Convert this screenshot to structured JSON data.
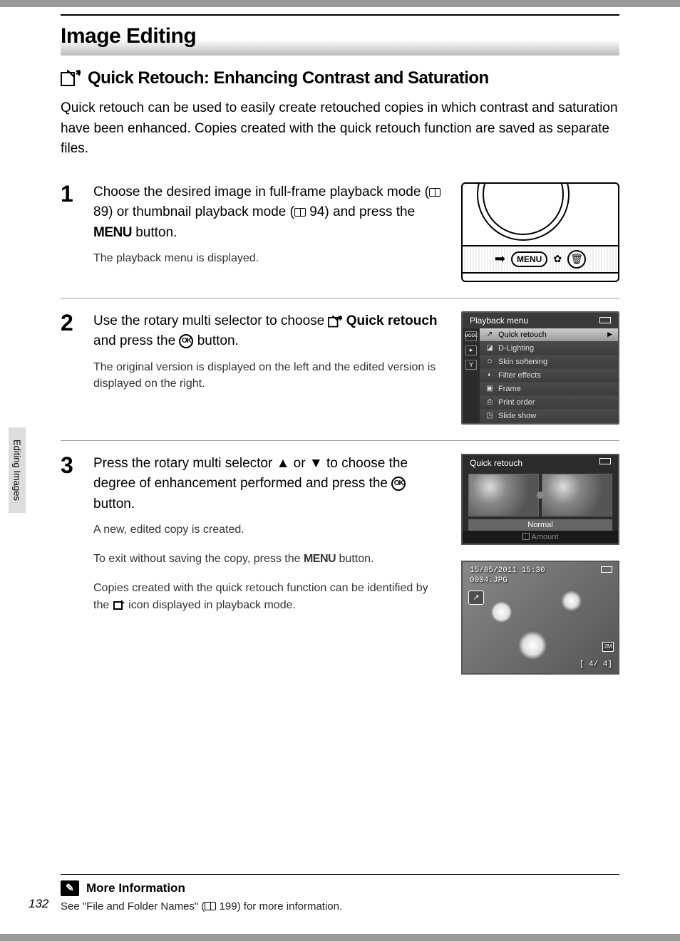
{
  "header": {
    "title": "Image Editing"
  },
  "section": {
    "heading": "Quick Retouch: Enhancing Contrast and Saturation"
  },
  "intro": "Quick retouch can be used to easily create retouched copies in which contrast and saturation have been enhanced. Copies created with the quick retouch function are saved as separate files.",
  "steps": [
    {
      "num": "1",
      "main_a": "Choose the desired image in full-frame playback mode (",
      "ref1": "89",
      "main_b": ") or thumbnail playback mode (",
      "ref2": "94",
      "main_c": ") and press the ",
      "btn": "MENU",
      "main_d": " button.",
      "sub": "The playback menu is displayed."
    },
    {
      "num": "2",
      "main_a": "Use the rotary multi selector to choose ",
      "strong": "Quick retouch",
      "main_b": " and press the ",
      "ok": "OK",
      "main_c": " button.",
      "sub": "The original version is displayed on the left and the edited version is displayed on the right."
    },
    {
      "num": "3",
      "main_a": "Press the rotary multi selector ",
      "glyph_up": "▲",
      "main_b": " or ",
      "glyph_down": "▼",
      "main_c": " to choose the degree of enhancement performed and press the ",
      "ok": "OK",
      "main_d": " button.",
      "sub1": "A new, edited copy is created.",
      "sub2a": "To exit without saving the copy, press the ",
      "sub2btn": "MENU",
      "sub2b": " button.",
      "sub3a": "Copies created with the quick retouch function can be identified by the ",
      "sub3b": " icon displayed in playback mode."
    }
  ],
  "camera": {
    "menu_label": "MENU"
  },
  "lcd_menu": {
    "title": "Playback menu",
    "items": [
      {
        "icon": "↗",
        "label": "Quick retouch",
        "selected": true
      },
      {
        "icon": "◪",
        "label": "D-Lighting"
      },
      {
        "icon": "☺",
        "label": "Skin softening"
      },
      {
        "icon": "◐",
        "label": "Filter effects"
      },
      {
        "icon": "▣",
        "label": "Frame"
      },
      {
        "icon": "⎙",
        "label": "Print order"
      },
      {
        "icon": "◳",
        "label": "Slide show"
      }
    ]
  },
  "lcd_preview": {
    "title": "Quick retouch",
    "level": "Normal",
    "amount": "Amount"
  },
  "playback": {
    "timestamp": "15/05/2011 15:30",
    "filename": "0004.JPG",
    "size": "2M",
    "counter": "[    4/    4]"
  },
  "sidetab": "Editing Images",
  "more": {
    "heading": "More Information",
    "text_a": "See \"File and Folder Names\" (",
    "ref": "199",
    "text_b": ") for more information."
  },
  "pagenum": "132"
}
